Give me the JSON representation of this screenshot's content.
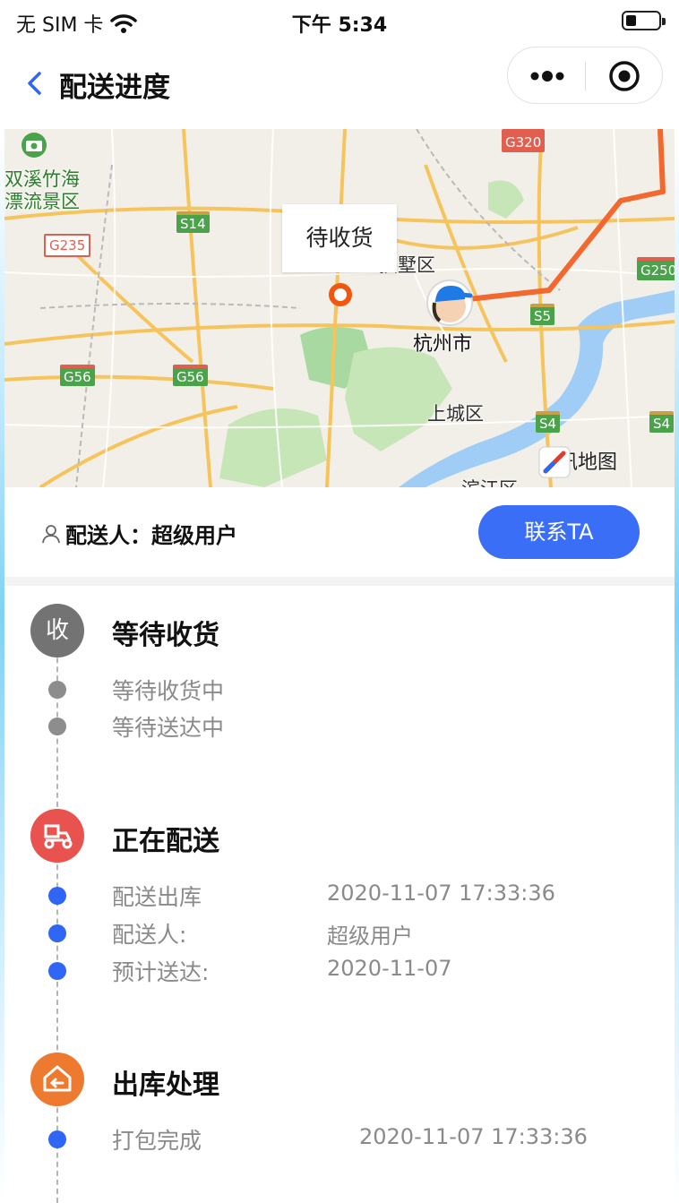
{
  "status_bar": {
    "carrier": "无 SIM 卡",
    "time": "下午 5:34",
    "battery_level": 0.3
  },
  "nav": {
    "title": "配送进度"
  },
  "map": {
    "callout": "待收货",
    "city_label": "杭州市",
    "districts": [
      "上城区",
      "拱墅区",
      "滨江区"
    ],
    "scenic_label_line1": "双溪竹海",
    "scenic_label_line2": "漂流景区",
    "roads": [
      "G320",
      "S14",
      "G235",
      "G250",
      "S5",
      "G56",
      "G56",
      "S4",
      "S4"
    ],
    "logo_text": "腾讯地图",
    "route_color": "#f2682f"
  },
  "courier": {
    "label": "配送人：超级用户",
    "contact_button": "联系TA"
  },
  "timeline": {
    "stages": [
      {
        "icon_text": "收",
        "color": "#737373",
        "title": "等待收货",
        "items": [
          {
            "label": "等待收货中",
            "value": ""
          },
          {
            "label": "等待送达中",
            "value": ""
          }
        ]
      },
      {
        "icon": "scooter-icon",
        "color": "#e9534f",
        "title": "正在配送",
        "items": [
          {
            "label": "配送出库",
            "value": "2020-11-07 17:33:36"
          },
          {
            "label": "配送人:",
            "value": "超级用户"
          },
          {
            "label": "预计送达:",
            "value": "2020-11-07"
          }
        ]
      },
      {
        "icon": "warehouse-out-icon",
        "color": "#ee7a2f",
        "title": "出库处理",
        "items": [
          {
            "label": "打包完成",
            "value": "2020-11-07 17:33:36"
          }
        ]
      }
    ]
  }
}
